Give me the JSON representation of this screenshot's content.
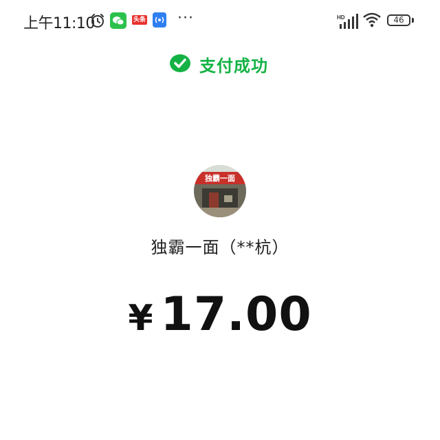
{
  "status_bar": {
    "time": "上午11:10",
    "toutiao_text": "头条",
    "battery": "46",
    "more": "···"
  },
  "header": {
    "title": "支付成功"
  },
  "merchant": {
    "name": "独霸一面（**杭）",
    "shop_sign": "独霸一面"
  },
  "payment": {
    "currency": "¥",
    "amount": "17.00"
  },
  "colors": {
    "accent": "#14b244",
    "shop_red": "#c8302a"
  }
}
